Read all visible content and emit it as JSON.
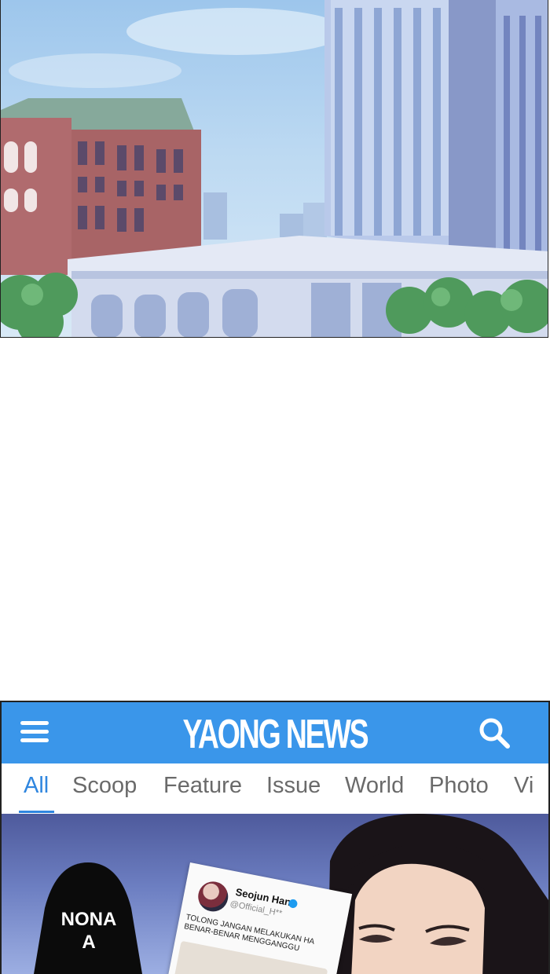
{
  "app": {
    "title": "YAONG NEWS",
    "tabs": [
      "All",
      "Scoop",
      "Feature",
      "Issue",
      "World",
      "Photo",
      "Vi"
    ],
    "active_tab": "All",
    "colors": {
      "header": "#3a96ea",
      "active_tab": "#2f86df",
      "inactive_tab": "#6a6a6a"
    },
    "icons": {
      "menu": "hamburger-menu-icon",
      "search": "search-icon"
    }
  },
  "article": {
    "speech_label": "NONA\nA",
    "tweet": {
      "name": "Seojun Han",
      "handle": "@Official_H**",
      "text": "TOLONG JANGAN MELAKUKAN HA\nBENAR-BENAR MENGGANGGU"
    }
  }
}
